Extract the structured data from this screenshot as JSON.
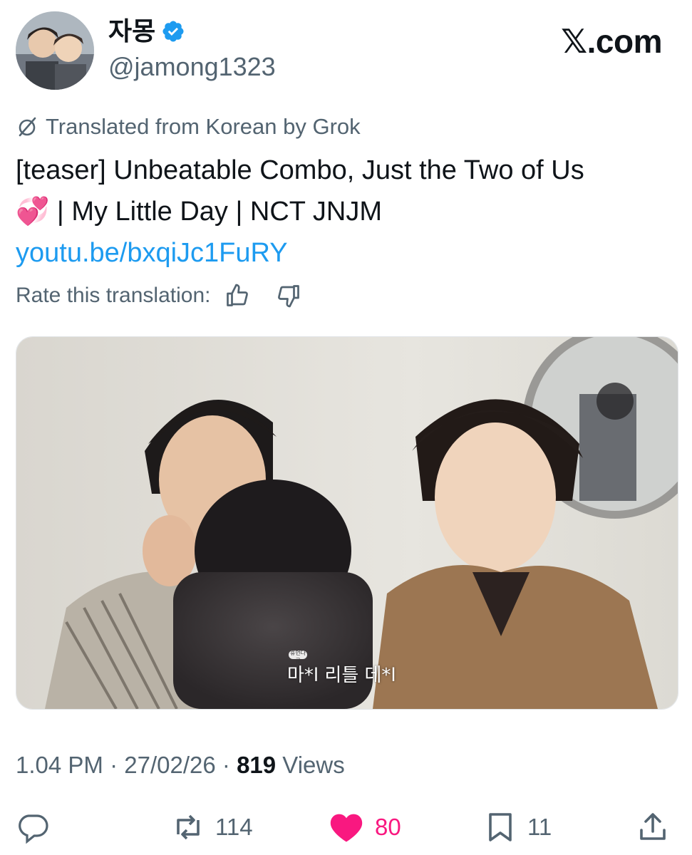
{
  "author": {
    "display_name": "자몽",
    "handle": "@jamong1323",
    "verified": true
  },
  "brand": {
    "logo_text": "𝕏.com"
  },
  "translation": {
    "label": "Translated from Korean by Grok",
    "rate_label": "Rate this translation:"
  },
  "tweet": {
    "line1": "[teaser] Unbeatable Combo, Just the Two of Us",
    "emoji": "💞",
    "line2": " | My Little Day | NCT JNJM",
    "link": "youtu.be/bxqiJc1FuRY"
  },
  "media": {
    "caption_small": "휴먼다큐",
    "caption_main": "마*l 리틀 데*l"
  },
  "meta": {
    "time": "1.04 PM",
    "date": "27/02/26",
    "views_count": "819",
    "views_label": "Views"
  },
  "actions": {
    "reply_count": "",
    "retweet_count": "114",
    "like_count": "80",
    "bookmark_count": "11"
  },
  "colors": {
    "accent": "#1d9bf0",
    "like": "#f91880",
    "muted": "#536471",
    "text": "#0f1419"
  }
}
